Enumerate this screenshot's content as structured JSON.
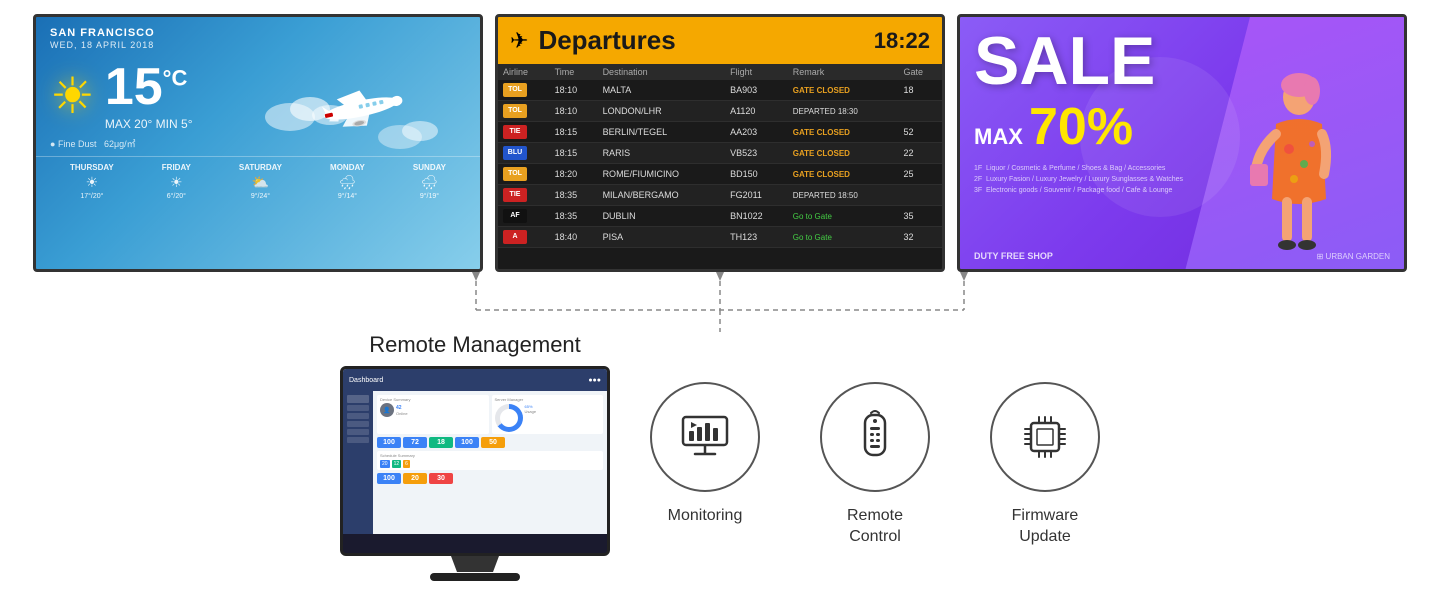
{
  "screens": {
    "weather": {
      "city": "SAN FRANCISCO",
      "date": "WED, 18 APRIL 2018",
      "temp": "15",
      "temp_unit": "°C",
      "max_temp": "20",
      "min_temp": "5",
      "fine_dust_label": "Fine Dust",
      "fine_dust_value": "62μg/㎥",
      "forecast": [
        {
          "day": "THURSDAY",
          "icon": "☀",
          "temp": "17°/20°"
        },
        {
          "day": "FRIDAY",
          "icon": "☀",
          "temp": "6°/20°"
        },
        {
          "day": "SATURDAY",
          "icon": "⛅",
          "temp": "9°/24°"
        },
        {
          "day": "MONDAY",
          "icon": "🌧",
          "temp": "9°/14°"
        },
        {
          "day": "SUNDAY",
          "icon": "🌧",
          "temp": "9°/19°"
        }
      ]
    },
    "departures": {
      "title": "Departures",
      "time": "18:22",
      "columns": [
        "Airline",
        "Time",
        "Destination",
        "Flight",
        "Remark",
        "Gate"
      ],
      "rows": [
        {
          "airline": "TOLLO",
          "logo_class": "logo-tollo",
          "time": "18:10",
          "destination": "MALTA",
          "flight": "BA903",
          "remark": "GATE CLOSED",
          "remark_class": "remark-closed",
          "gate": "18"
        },
        {
          "airline": "TOLLO",
          "logo_class": "logo-tollo",
          "time": "18:10",
          "destination": "LONDON/LHR",
          "flight": "A1120",
          "remark": "DEPARTED 18:30",
          "remark_class": "remark-departed",
          "gate": ""
        },
        {
          "airline": "TIE",
          "logo_class": "logo-tie",
          "time": "18:15",
          "destination": "BERLIN/TEGEL",
          "flight": "AA203",
          "remark": "GATE CLOSED",
          "remark_class": "remark-closed",
          "gate": "52"
        },
        {
          "airline": "BLU",
          "logo_class": "logo-blu",
          "time": "18:15",
          "destination": "RARIS",
          "flight": "VB523",
          "remark": "GATE CLOSED",
          "remark_class": "remark-closed",
          "gate": "22"
        },
        {
          "airline": "TOLLO",
          "logo_class": "logo-tollo",
          "time": "18:20",
          "destination": "ROME/FIUMICINO",
          "flight": "BD150",
          "remark": "GATE CLOSED",
          "remark_class": "remark-closed",
          "gate": "25"
        },
        {
          "airline": "TIE",
          "logo_class": "logo-tie",
          "time": "18:35",
          "destination": "MILAN/BERGAMO",
          "flight": "FG2011",
          "remark": "DEPARTED 18:50",
          "remark_class": "remark-departed",
          "gate": ""
        },
        {
          "airline": "AF",
          "logo_class": "logo-af",
          "time": "18:35",
          "destination": "DUBLIN",
          "flight": "BN1022",
          "remark": "Go to Gate",
          "remark_class": "remark-go",
          "gate": "35"
        },
        {
          "airline": "A",
          "logo_class": "logo-a",
          "time": "18:40",
          "destination": "PISA",
          "flight": "TH123",
          "remark": "Go to Gate",
          "remark_class": "remark-go",
          "gate": "32"
        }
      ]
    },
    "sale": {
      "sale_text": "SALE",
      "max_label": "MAX",
      "percent": "70%",
      "floors": [
        "1F  Liquor / Cosmetic & Perfume / Shoes & Bag / Accessories",
        "2F  Luxury Fasion / Luxury Jewelry / Luxury Sunglasses & Watches",
        "3F  Electronic goods / Souvenir / Package food / Cafe & Lounge"
      ],
      "store_name": "DUTY FREE SHOP",
      "brand": "⊞ URBAN GARDEN"
    }
  },
  "management": {
    "label": "Remote Management",
    "features": [
      {
        "name": "monitoring",
        "label": "Monitoring",
        "icon": "monitor"
      },
      {
        "name": "remote-control",
        "label": "Remote\nControl",
        "label_line1": "Remote",
        "label_line2": "Control",
        "icon": "remote"
      },
      {
        "name": "firmware-update",
        "label": "Firmware\nUpdate",
        "label_line1": "Firmware",
        "label_line2": "Update",
        "icon": "chip"
      }
    ]
  }
}
